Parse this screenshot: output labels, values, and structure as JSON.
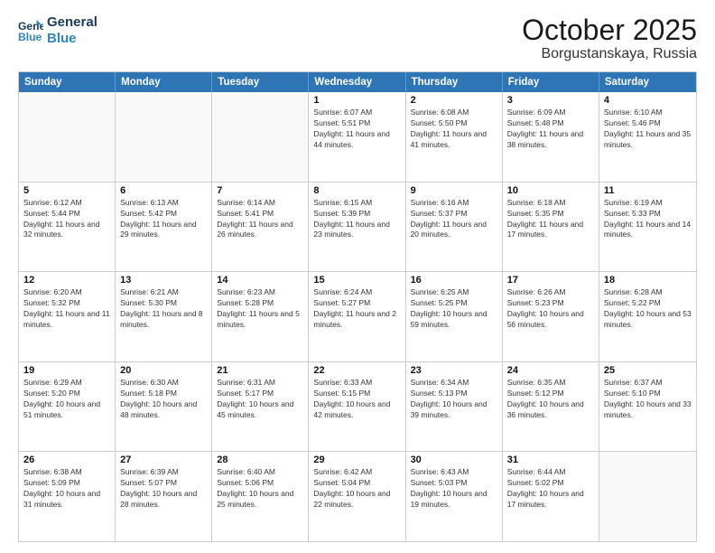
{
  "logo": {
    "line1": "General",
    "line2": "Blue"
  },
  "title": "October 2025",
  "subtitle": "Borgustanskaya, Russia",
  "days": [
    "Sunday",
    "Monday",
    "Tuesday",
    "Wednesday",
    "Thursday",
    "Friday",
    "Saturday"
  ],
  "weeks": [
    [
      {
        "num": "",
        "info": ""
      },
      {
        "num": "",
        "info": ""
      },
      {
        "num": "",
        "info": ""
      },
      {
        "num": "1",
        "info": "Sunrise: 6:07 AM\nSunset: 5:51 PM\nDaylight: 11 hours and 44 minutes."
      },
      {
        "num": "2",
        "info": "Sunrise: 6:08 AM\nSunset: 5:50 PM\nDaylight: 11 hours and 41 minutes."
      },
      {
        "num": "3",
        "info": "Sunrise: 6:09 AM\nSunset: 5:48 PM\nDaylight: 11 hours and 38 minutes."
      },
      {
        "num": "4",
        "info": "Sunrise: 6:10 AM\nSunset: 5:46 PM\nDaylight: 11 hours and 35 minutes."
      }
    ],
    [
      {
        "num": "5",
        "info": "Sunrise: 6:12 AM\nSunset: 5:44 PM\nDaylight: 11 hours and 32 minutes."
      },
      {
        "num": "6",
        "info": "Sunrise: 6:13 AM\nSunset: 5:42 PM\nDaylight: 11 hours and 29 minutes."
      },
      {
        "num": "7",
        "info": "Sunrise: 6:14 AM\nSunset: 5:41 PM\nDaylight: 11 hours and 26 minutes."
      },
      {
        "num": "8",
        "info": "Sunrise: 6:15 AM\nSunset: 5:39 PM\nDaylight: 11 hours and 23 minutes."
      },
      {
        "num": "9",
        "info": "Sunrise: 6:16 AM\nSunset: 5:37 PM\nDaylight: 11 hours and 20 minutes."
      },
      {
        "num": "10",
        "info": "Sunrise: 6:18 AM\nSunset: 5:35 PM\nDaylight: 11 hours and 17 minutes."
      },
      {
        "num": "11",
        "info": "Sunrise: 6:19 AM\nSunset: 5:33 PM\nDaylight: 11 hours and 14 minutes."
      }
    ],
    [
      {
        "num": "12",
        "info": "Sunrise: 6:20 AM\nSunset: 5:32 PM\nDaylight: 11 hours and 11 minutes."
      },
      {
        "num": "13",
        "info": "Sunrise: 6:21 AM\nSunset: 5:30 PM\nDaylight: 11 hours and 8 minutes."
      },
      {
        "num": "14",
        "info": "Sunrise: 6:23 AM\nSunset: 5:28 PM\nDaylight: 11 hours and 5 minutes."
      },
      {
        "num": "15",
        "info": "Sunrise: 6:24 AM\nSunset: 5:27 PM\nDaylight: 11 hours and 2 minutes."
      },
      {
        "num": "16",
        "info": "Sunrise: 6:25 AM\nSunset: 5:25 PM\nDaylight: 10 hours and 59 minutes."
      },
      {
        "num": "17",
        "info": "Sunrise: 6:26 AM\nSunset: 5:23 PM\nDaylight: 10 hours and 56 minutes."
      },
      {
        "num": "18",
        "info": "Sunrise: 6:28 AM\nSunset: 5:22 PM\nDaylight: 10 hours and 53 minutes."
      }
    ],
    [
      {
        "num": "19",
        "info": "Sunrise: 6:29 AM\nSunset: 5:20 PM\nDaylight: 10 hours and 51 minutes."
      },
      {
        "num": "20",
        "info": "Sunrise: 6:30 AM\nSunset: 5:18 PM\nDaylight: 10 hours and 48 minutes."
      },
      {
        "num": "21",
        "info": "Sunrise: 6:31 AM\nSunset: 5:17 PM\nDaylight: 10 hours and 45 minutes."
      },
      {
        "num": "22",
        "info": "Sunrise: 6:33 AM\nSunset: 5:15 PM\nDaylight: 10 hours and 42 minutes."
      },
      {
        "num": "23",
        "info": "Sunrise: 6:34 AM\nSunset: 5:13 PM\nDaylight: 10 hours and 39 minutes."
      },
      {
        "num": "24",
        "info": "Sunrise: 6:35 AM\nSunset: 5:12 PM\nDaylight: 10 hours and 36 minutes."
      },
      {
        "num": "25",
        "info": "Sunrise: 6:37 AM\nSunset: 5:10 PM\nDaylight: 10 hours and 33 minutes."
      }
    ],
    [
      {
        "num": "26",
        "info": "Sunrise: 6:38 AM\nSunset: 5:09 PM\nDaylight: 10 hours and 31 minutes."
      },
      {
        "num": "27",
        "info": "Sunrise: 6:39 AM\nSunset: 5:07 PM\nDaylight: 10 hours and 28 minutes."
      },
      {
        "num": "28",
        "info": "Sunrise: 6:40 AM\nSunset: 5:06 PM\nDaylight: 10 hours and 25 minutes."
      },
      {
        "num": "29",
        "info": "Sunrise: 6:42 AM\nSunset: 5:04 PM\nDaylight: 10 hours and 22 minutes."
      },
      {
        "num": "30",
        "info": "Sunrise: 6:43 AM\nSunset: 5:03 PM\nDaylight: 10 hours and 19 minutes."
      },
      {
        "num": "31",
        "info": "Sunrise: 6:44 AM\nSunset: 5:02 PM\nDaylight: 10 hours and 17 minutes."
      },
      {
        "num": "",
        "info": ""
      }
    ]
  ]
}
